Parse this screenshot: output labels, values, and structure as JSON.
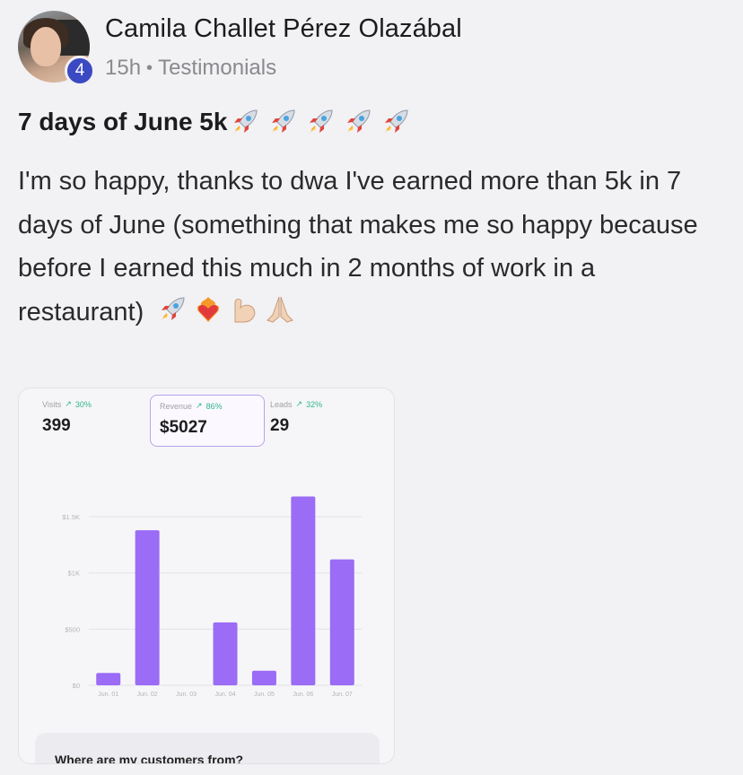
{
  "post": {
    "author": "Camila Challet Pérez Olazábal",
    "level": "4",
    "time": "15h",
    "category": "Testimonials",
    "title": "7 days of June 5k",
    "body": "I'm so happy, thanks to dwa I've earned more than 5k in 7 days of June (something that makes me so happy because before I earned this much in 2 months of work in a restaurant)",
    "title_emojis": [
      "rocket-icon",
      "rocket-icon",
      "rocket-icon",
      "rocket-icon",
      "rocket-icon"
    ],
    "body_emojis": [
      "rocket-icon",
      "heart-on-fire-icon",
      "flexed-biceps-icon",
      "folded-hands-icon"
    ]
  },
  "dashboard": {
    "stats": [
      {
        "label": "Visits",
        "change": "30%",
        "value": "399"
      },
      {
        "label": "Revenue",
        "change": "86%",
        "value": "$5027"
      },
      {
        "label": "Leads",
        "change": "32%",
        "value": "29"
      }
    ],
    "bottom_heading": "Where are my customers from?"
  },
  "chart_data": {
    "type": "bar",
    "categories": [
      "Jun. 01",
      "Jun. 02",
      "Jun. 03",
      "Jun. 04",
      "Jun. 05",
      "Jun. 06",
      "Jun. 07"
    ],
    "values": [
      110,
      1380,
      0,
      560,
      130,
      1680,
      1120
    ],
    "y_ticks": [
      {
        "label": "$0",
        "value": 0
      },
      {
        "label": "$500",
        "value": 500
      },
      {
        "label": "$1K",
        "value": 1000
      },
      {
        "label": "$1.5K",
        "value": 1500
      }
    ],
    "ylim": [
      0,
      1700
    ],
    "grid": true,
    "bar_color": "#9b6cf5"
  },
  "colors": {
    "accent_purple": "#9b6cf5",
    "badge_blue": "#3b49c2",
    "trend_green": "#32b58a"
  }
}
